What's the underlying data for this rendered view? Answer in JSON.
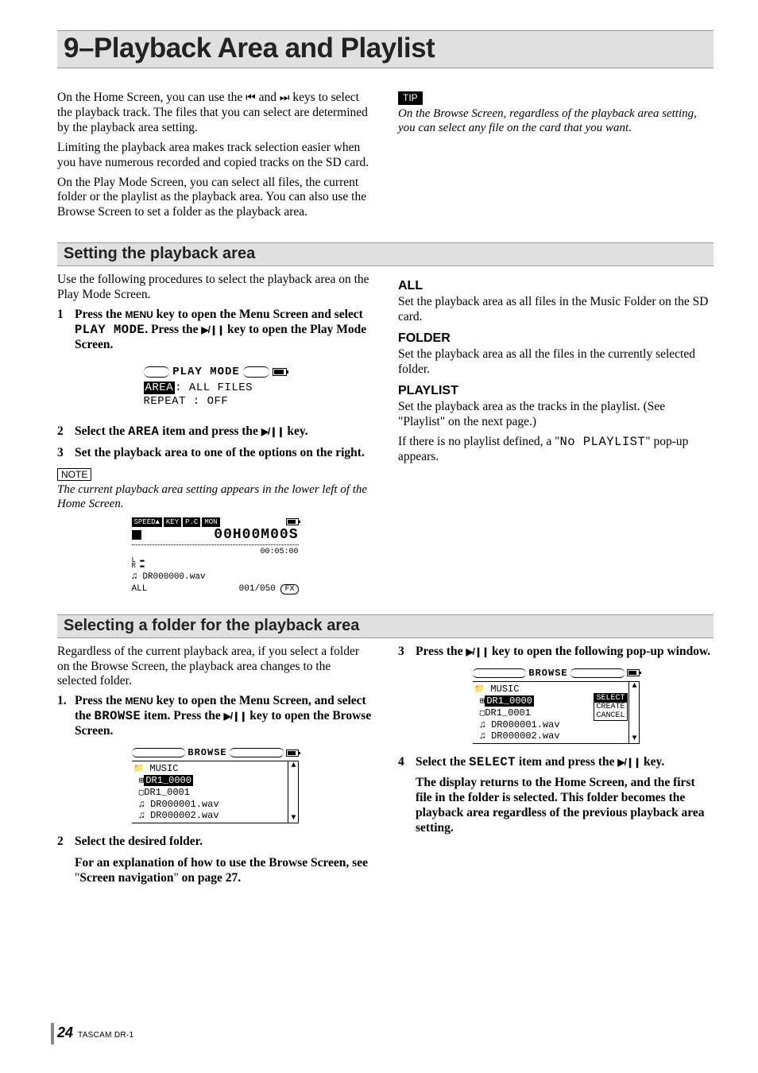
{
  "page_title": "9–Playback Area and Playlist",
  "footer": {
    "page": "24",
    "product": "TASCAM DR-1"
  },
  "intro": {
    "p1a": "On the Home Screen, you can use the ",
    "p1b": " keys to select the playback track. The files that you can select are determined by the playback area setting.",
    "p1and": " and ",
    "p2": "Limiting the playback area makes track selection easier when you have numerous recorded and copied tracks on the SD card.",
    "p3": "On the Play Mode Screen, you can select all files, the current folder or the playlist as the playback area. You can also use the Browse Screen to set a folder as the playback area."
  },
  "tip": {
    "label": "TIP",
    "text": "On the Browse Screen, regardless of the playback area setting, you can select any file on the card that you want."
  },
  "sec1": {
    "heading": "Setting the playback area",
    "p": "Use the following procedures to select the playback area on the Play Mode Screen.",
    "s1a": "Press the ",
    "s1menu": "MENU",
    "s1b": " key to open the Menu Screen and select ",
    "s1mono": "PLAY MODE",
    "s1c": ". Press the ",
    "s1d": " key to open the Play Mode Screen.",
    "lcd1": {
      "title": "PLAY MODE",
      "row1_label": "AREA",
      "row1_val": ": ALL FILES",
      "row2": "REPEAT : OFF"
    },
    "s2a": "Select the ",
    "s2mono": "AREA",
    "s2b": " item and press the ",
    "s2c": " key.",
    "s3": "Set the playback area to one of the options on the right.",
    "note_label": "NOTE",
    "note_text": "The current playback area setting appears in the lower left of the Home Screen.",
    "lcd_home": {
      "chips": [
        "SPEED▲",
        "KEY",
        "P.C",
        "MON"
      ],
      "time_big": "00H00M00S",
      "time_small": "00:05:00",
      "file": "DR000000.wav",
      "area": "ALL",
      "counter": "001/050",
      "fx": "FX"
    },
    "all_h": "ALL",
    "all_p": "Set the playback area as all files in the Music Folder on the SD card.",
    "folder_h": "FOLDER",
    "folder_p": "Set the playback area as all the files in the currently selected folder.",
    "playlist_h": "PLAYLIST",
    "playlist_p1": "Set the playback area as the tracks in the playlist. (See \"Playlist\" on the next page.)",
    "playlist_p2a": "If there is no playlist defined, a \"",
    "playlist_mono": "No PLAYLIST",
    "playlist_p2b": "\" pop-up appears."
  },
  "sec2": {
    "heading": "Selecting a folder for the playback area",
    "p": "Regardless of the current playback area, if you select a folder on the Browse Screen, the playback area changes to the selected folder.",
    "s1a": "Press the ",
    "s1menu": "MENU",
    "s1b": " key to open the Menu Screen, and select the ",
    "s1mono": "BROWSE",
    "s1c": " item. Press the ",
    "s1d": " key to open the Browse Screen.",
    "lcd_browse": {
      "title": "BROWSE",
      "rows": [
        "MUSIC",
        "DR1_0000",
        "DR1_0001",
        "DR000001.wav",
        "DR000002.wav"
      ]
    },
    "s2": "Select the desired folder.",
    "s2p_a": "For an explanation of how to use the Browse Screen, see ",
    "s2p_q1": "\"",
    "s2p_bold": "Screen navigation",
    "s2p_q2": "\"",
    "s2p_b": " on page 27.",
    "s3a": "Press the ",
    "s3b": " key to open the following pop-up window.",
    "lcd_popup": {
      "title": "BROWSE",
      "rows": [
        "MUSIC",
        "DR1_0000",
        "DR1_0001",
        "DR000001.wav",
        "DR000002.wav"
      ],
      "popup": [
        "SELECT",
        "CREATE",
        "CANCEL"
      ]
    },
    "s4a": "Select the ",
    "s4mono": "SELECT",
    "s4b": " item and press the ",
    "s4c": " key.",
    "s4p": "The display returns to the Home Screen, and the first file in the folder is selected. This folder becomes the playback area regardless of the previous playback area setting."
  }
}
